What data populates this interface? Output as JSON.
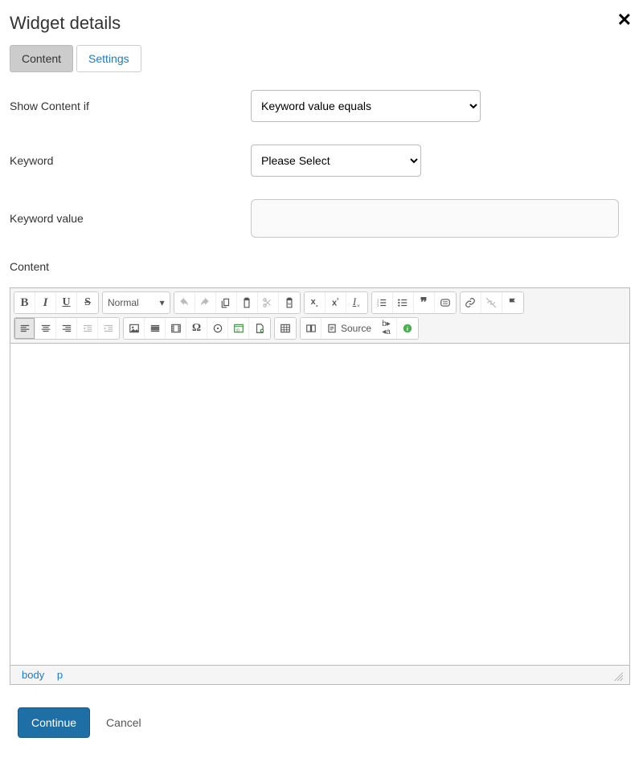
{
  "modal": {
    "title": "Widget details"
  },
  "tabs": {
    "content": "Content",
    "settings": "Settings"
  },
  "form": {
    "show_if_label": "Show Content if",
    "show_if_value": "Keyword value equals",
    "keyword_label": "Keyword",
    "keyword_value": "Please Select",
    "keyword_value_label": "Keyword value",
    "keyword_value_input": ""
  },
  "content_label": "Content",
  "editor": {
    "format_dropdown": "Normal",
    "source_label": "Source",
    "path": {
      "body": "body",
      "p": "p"
    }
  },
  "actions": {
    "continue": "Continue",
    "cancel": "Cancel"
  }
}
